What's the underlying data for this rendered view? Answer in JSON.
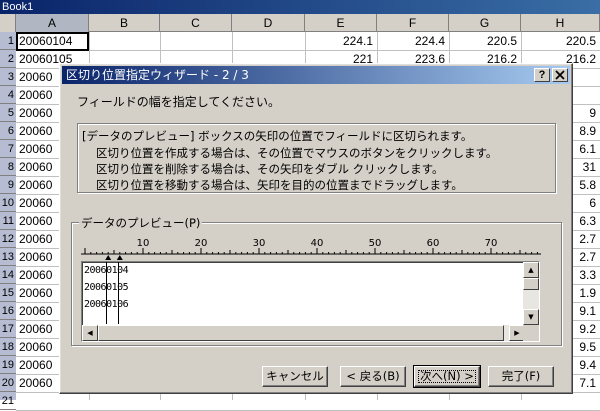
{
  "window": {
    "title": "Book1"
  },
  "sheet": {
    "columns": [
      "A",
      "B",
      "C",
      "D",
      "E",
      "F",
      "G",
      "H"
    ],
    "row_numbers": [
      "1",
      "2",
      "3",
      "4",
      "5",
      "6",
      "7",
      "8",
      "9",
      "10",
      "11",
      "12",
      "13",
      "14",
      "15",
      "16",
      "17",
      "18",
      "19",
      "20",
      "21"
    ],
    "row1": [
      "20060104",
      "",
      "",
      "",
      "224.1",
      "224.4",
      "220.5",
      "220.5"
    ],
    "row2_partial": [
      "20060105",
      "",
      "",
      "",
      "221",
      "223.6",
      "216.2",
      "216.2"
    ],
    "col_a_visible": [
      "20060",
      "20060",
      "20060",
      "20060",
      "20060",
      "20060",
      "20060",
      "20060",
      "20060",
      "20060",
      "20060",
      "20060",
      "20060",
      "20060",
      "20060",
      "20060",
      "20060",
      "20060"
    ],
    "col_h_visible": [
      "",
      "",
      "9",
      "8.9",
      "6.1",
      "31",
      "5.8",
      "6",
      "6.3",
      "2.7",
      "2.7",
      "3.3",
      "1.9",
      "9.1",
      "9.2",
      "9.5",
      "9.4",
      "7.1"
    ]
  },
  "dialog": {
    "title": "区切り位置指定ウィザード - 2 / 3",
    "help_btn": "?",
    "close_btn": "X",
    "instruction": "フィールドの幅を指定してください。",
    "info_lines": [
      "[データのプレビュー] ボックスの矢印の位置でフィールドに区切られます。",
      "区切り位置を作成する場合は、その位置でマウスのボタンをクリックします。",
      "区切り位置を削除する場合は、その矢印をダブル クリックします。",
      "区切り位置を移動する場合は、矢印を目的の位置までドラッグします。"
    ],
    "preview_label": "データのプレビュー(P)",
    "ruler_ticks": [
      "10",
      "20",
      "30",
      "40",
      "50",
      "60",
      "70"
    ],
    "preview_lines": [
      "20060104",
      "20060105",
      "20060106"
    ],
    "buttons": {
      "cancel": "キャンセル",
      "back": "< 戻る(B)",
      "next": "次へ(N) >",
      "finish": "完了(F)"
    }
  }
}
